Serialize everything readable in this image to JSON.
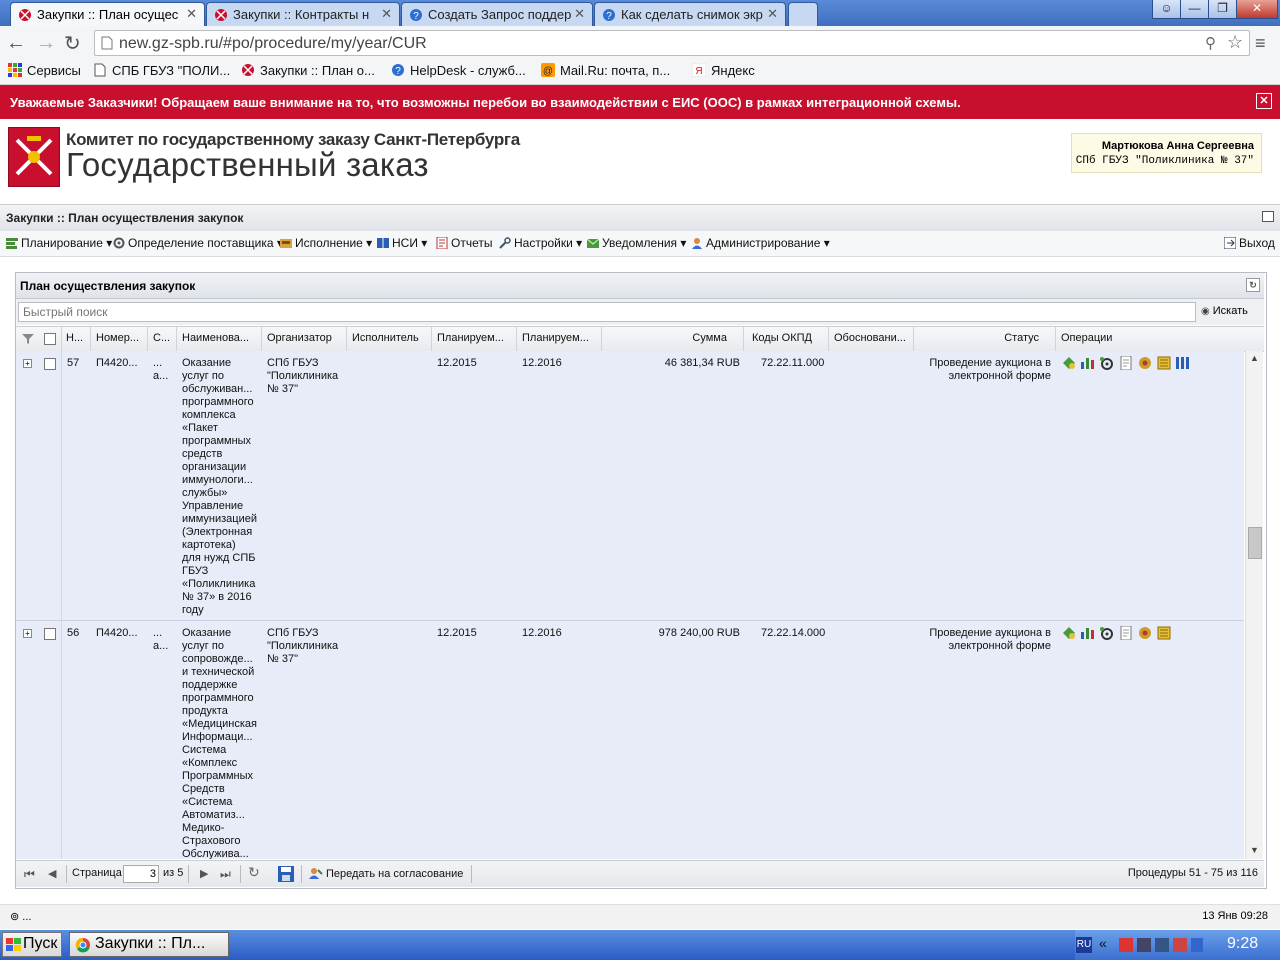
{
  "browser": {
    "tabs": [
      {
        "label": "Закупки :: План осущес",
        "active": true,
        "icon": "gz-icon"
      },
      {
        "label": "Закупки :: Контракты н",
        "active": false,
        "icon": "gz-icon"
      },
      {
        "label": "Создать Запрос поддер",
        "active": false,
        "icon": "help-icon"
      },
      {
        "label": "Как сделать снимок экр",
        "active": false,
        "icon": "help-icon"
      }
    ],
    "close_glyph": "✕",
    "url": "new.gz-spb.ru/#po/procedure/my/year/CUR",
    "bookmarks": [
      {
        "label": "Сервисы",
        "icon": "apps-icon"
      },
      {
        "label": "СПБ ГБУЗ \"ПОЛИ...",
        "icon": "page-icon"
      },
      {
        "label": "Закупки :: План о...",
        "icon": "gz-icon"
      },
      {
        "label": "HelpDesk - служб...",
        "icon": "help-icon"
      },
      {
        "label": "Mail.Ru: почта, п...",
        "icon": "mail-icon"
      },
      {
        "label": "Яндекс",
        "icon": "yandex-icon"
      }
    ]
  },
  "alert": {
    "text": "Уважаемые Заказчики! Обращаем ваше внимание на то, что возможны перебои во взаимодействии с ЕИС (ООС) в рамках интеграционной схемы.",
    "close_glyph": "✕"
  },
  "header": {
    "org": "Комитет по государственному заказу Санкт-Петербурга",
    "system": "Государственный заказ",
    "user_name": "Мартюкова Анна Сергеевна",
    "user_org": "СПб ГБУЗ \"Поликлиника № 37\""
  },
  "app": {
    "title": "Закупки :: План осуществления закупок",
    "menu": [
      {
        "label": "Планирование",
        "icon": "planning-icon"
      },
      {
        "label": "Определение поставщика",
        "icon": "gears-icon"
      },
      {
        "label": "Исполнение",
        "icon": "execution-icon"
      },
      {
        "label": "НСИ",
        "icon": "book-icon"
      },
      {
        "label": "Отчеты",
        "icon": "report-icon"
      },
      {
        "label": "Настройки",
        "icon": "wrench-icon"
      },
      {
        "label": "Уведомления",
        "icon": "notification-icon"
      },
      {
        "label": "Администрирование",
        "icon": "admin-icon"
      }
    ],
    "logout": "Выход"
  },
  "panel": {
    "title": "План осуществления закупок",
    "search_placeholder": "Быстрый поиск",
    "search_button": "Искать",
    "columns": [
      "Н...",
      "Номер...",
      "С...",
      "Наименова...",
      "Организатор",
      "Исполнитель",
      "Планируем...",
      "Планируем...",
      "Сумма",
      "Коды ОКПД",
      "Обосновани...",
      "Статус",
      "Операции"
    ],
    "rows": [
      {
        "num": "57",
        "number": "П4420...",
        "s": "...\nа...",
        "name": "Оказание\nуслуг по\nобслуживан...\nпрограммного\nкомплекса\n«Пакет\nпрограммных\nсредств\nорганизации\nиммунологи...\nслужбы»\nУправление\nиммунизацией\n(Электронная\nкартотека)\nдля нужд СПБ\nГБУЗ\n«Поликлиника\n№ 37» в 2016\nгоду",
        "organizer": "СПб ГБУЗ\n\"Поликлиника\n№ 37\"",
        "executor": "",
        "plan1": "12.2015",
        "plan2": "12.2016",
        "sum": "46 381,34 RUB",
        "okpd": "72.22.11.000",
        "basis": "",
        "status": "Проведение аукциона в\nэлектронной форме"
      },
      {
        "num": "56",
        "number": "П4420...",
        "s": "...\nа...",
        "name": "Оказание\nуслуг по\nсопровожде...\nи технической\nподдержке\nпрограммного\nпродукта\n«Медицинская\nИнформаци...\nСистема\n«Комплекс\nПрограммных\nСредств\n«Система\nАвтоматиз...\nМедико-\nСтрахового\nОбслужива...",
        "organizer": "СПб ГБУЗ\n\"Поликлиника\n№ 37\"",
        "executor": "",
        "plan1": "12.2015",
        "plan2": "12.2016",
        "sum": "978 240,00 RUB",
        "okpd": "72.22.14.000",
        "basis": "",
        "status": "Проведение аукциона в\nэлектронной форме"
      }
    ],
    "pager": {
      "page_label": "Страница",
      "page_value": "3",
      "of_label": "из 5",
      "submit_label": "Передать на согласование",
      "summary": "Процедуры 51 - 75 из 116"
    }
  },
  "status_bar": {
    "left": "⊚ ...",
    "right": "13 Янв 09:28"
  },
  "taskbar": {
    "start": "Пуск",
    "item": "Закупки :: Пл...",
    "lang": "RU",
    "clock": "9:28"
  },
  "colors": {
    "alert": "#c8102e",
    "row_bg": "#e8ecf8",
    "taskbar": "#2a5cc4"
  }
}
